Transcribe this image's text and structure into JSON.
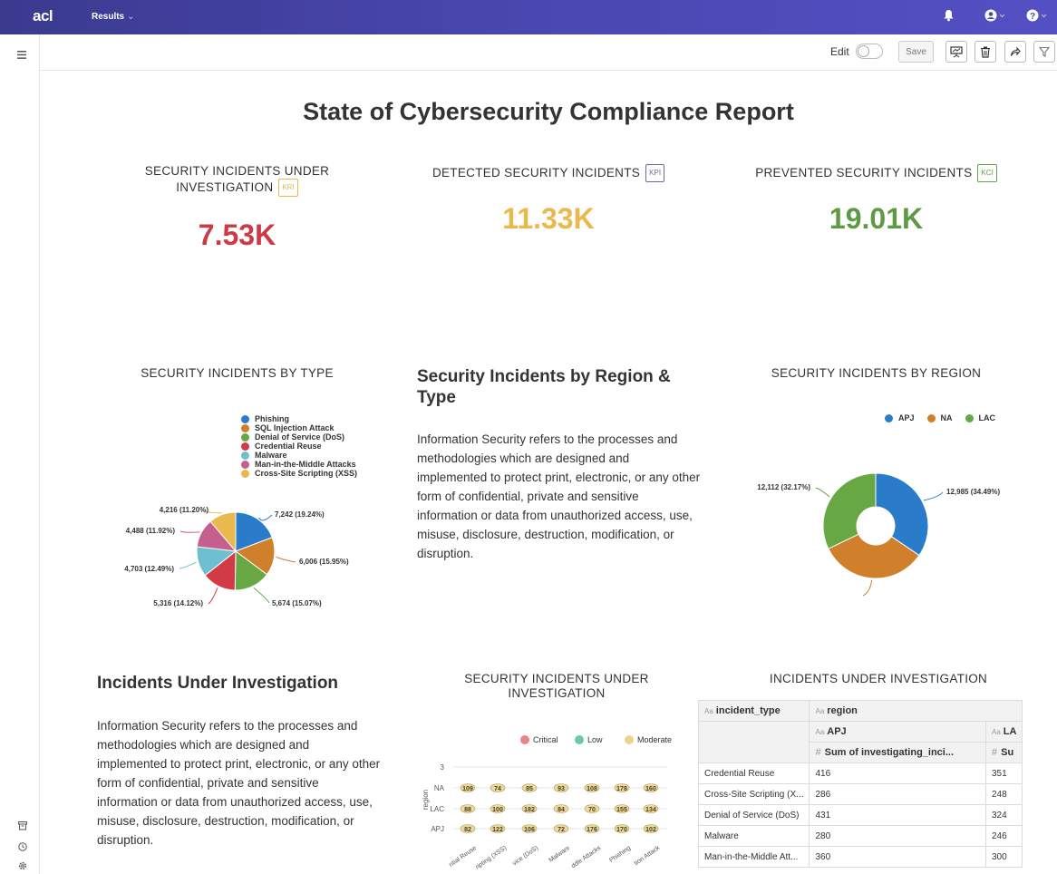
{
  "topbar": {
    "logo": "acl",
    "breadcrumb": "Results",
    "caret": "⌄",
    "icons": [
      "bell-icon",
      "user-icon",
      "help-icon"
    ]
  },
  "actionbar": {
    "edit_label": "Edit",
    "save_label": "Save",
    "icons": [
      "present-icon",
      "trash-icon",
      "share-icon",
      "filter-icon"
    ]
  },
  "report": {
    "title": "State of Cybersecurity Compliance Report"
  },
  "kpis": [
    {
      "label": "SECURITY INCIDENTS UNDER INVESTIGATION",
      "badge": "KRI",
      "value": "7.53K",
      "color": "#cc3a45",
      "badge_color": "#e8b84a"
    },
    {
      "label": "DETECTED SECURITY INCIDENTS",
      "badge": "KPI",
      "value": "11.33K",
      "color": "#e9b94d",
      "badge_color": "#6b6b9e"
    },
    {
      "label": "PREVENTED SECURITY INCIDENTS",
      "badge": "KCI",
      "value": "19.01K",
      "color": "#5e9a45",
      "badge_color": "#5ea548"
    }
  ],
  "sections": {
    "by_type_title": "SECURITY INCIDENTS BY TYPE",
    "region_type_heading": "Security Incidents by Region & Type",
    "region_type_text": "Information Security refers to the processes and methodologies which are designed and implemented to protect print, electronic, or any other form of confidential, private and sensitive information or data from unauthorized access, use, misuse, disclosure, destruction, modification, or disruption.",
    "by_region_title": "SECURITY INCIDENTS BY REGION",
    "investigation_heading": "Incidents Under Investigation",
    "investigation_text": "Information Security refers to the processes and methodologies which are designed and implemented to protect print, electronic, or any other form of confidential, private and sensitive information or data from unauthorized access, use, misuse, disclosure, destruction, modification, or disruption.",
    "bubble_title": "SECURITY INCIDENTS UNDER INVESTIGATION",
    "table_title": "INCIDENTS UNDER INVESTIGATION"
  },
  "chart_data": [
    {
      "type": "pie",
      "title": "SECURITY INCIDENTS BY TYPE",
      "categories": [
        "Phishing",
        "SQL Injection Attack",
        "Denial of Service (DoS)",
        "Credential Reuse",
        "Malware",
        "Man-in-the-Middle Attacks",
        "Cross-Site Scripting (XSS)"
      ],
      "values": [
        7242,
        6006,
        5674,
        5316,
        4703,
        4488,
        4216
      ],
      "labels": [
        "7,242 (19.24%)",
        "6,006 (15.95%)",
        "5,674 (15.07%)",
        "5,316 (14.12%)",
        "4,703 (12.49%)",
        "4,488 (11.92%)",
        "4,216 (11.20%)"
      ],
      "colors": [
        "#2a7ccb",
        "#d07f2b",
        "#67a845",
        "#d23a45",
        "#6ec0d0",
        "#c45f8e",
        "#e9b94d"
      ],
      "legend": "top-right"
    },
    {
      "type": "pie",
      "title": "SECURITY INCIDENTS BY REGION",
      "donut": true,
      "categories": [
        "APJ",
        "NA",
        "LAC"
      ],
      "values": [
        12985,
        12548,
        12112
      ],
      "labels": [
        "12,985 (34.49%)",
        "12,548 (33.33%)",
        "12,112 (32.17%)"
      ],
      "colors": [
        "#2a7ccb",
        "#d07f2b",
        "#67a845"
      ],
      "legend": "top-right"
    },
    {
      "type": "scatter",
      "title": "SECURITY INCIDENTS UNDER INVESTIGATION",
      "ylabel": "region",
      "y_categories": [
        "3",
        "NA",
        "LAC",
        "APJ"
      ],
      "x_categories": [
        "Credential Reuse",
        "Cross-Site Scripting (XSS)",
        "Denial of Service (DoS)",
        "Malware",
        "Man-in-the-Middle Attacks",
        "Phishing",
        "SQL Injection Attack"
      ],
      "x_tick_labels": [
        "ntial Reuse",
        "ripting (XSS)",
        "vice (DoS)",
        "Malware",
        "ddle Attacks",
        "Phishing",
        "tion Attack"
      ],
      "legend_entries": [
        "Critical",
        "Low",
        "Moderate"
      ],
      "legend_colors": [
        "#e98686",
        "#6cc9a4",
        "#efd28a"
      ],
      "legend": "top",
      "rows": [
        {
          "region": "NA",
          "values": [
            "109",
            "74",
            "85",
            "93",
            "108",
            "178",
            "160"
          ]
        },
        {
          "region": "LAC",
          "values": [
            "88",
            "100",
            "182",
            "84",
            "70",
            "155",
            "134"
          ]
        },
        {
          "region": "APJ",
          "values": [
            "82",
            "122",
            "106",
            "72",
            "176",
            "170",
            "102"
          ]
        }
      ]
    }
  ],
  "table": {
    "col1_header": "incident_type",
    "col2_header": "region",
    "sub_apj": "APJ",
    "sub_la": "LA",
    "measure_label": "Sum of investigating_inci...",
    "measure_label_2": "Su",
    "type_prefix": "Aa",
    "hash": "#",
    "rows": [
      {
        "type": "Credential Reuse",
        "apj": "416",
        "lac": "351"
      },
      {
        "type": "Cross-Site Scripting (X...",
        "apj": "286",
        "lac": "248"
      },
      {
        "type": "Denial of Service (DoS)",
        "apj": "431",
        "lac": "324"
      },
      {
        "type": "Malware",
        "apj": "280",
        "lac": "246"
      },
      {
        "type": "Man-in-the-Middle Att...",
        "apj": "360",
        "lac": "300"
      }
    ]
  }
}
